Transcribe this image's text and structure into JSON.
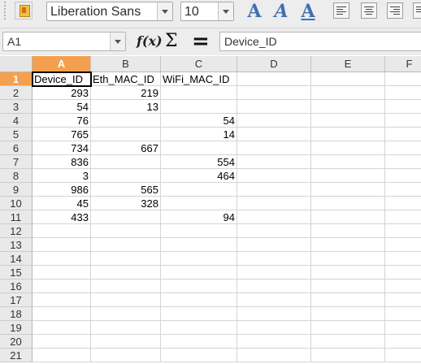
{
  "toolbar": {
    "font_name": "Liberation Sans",
    "font_size": "10",
    "format_buttons": [
      {
        "icon": "font-effect-icon",
        "glyph": "A"
      },
      {
        "icon": "italic-icon",
        "glyph": "A"
      },
      {
        "icon": "underline-icon",
        "glyph": "A"
      }
    ],
    "align_buttons": [
      "align-left-icon",
      "align-center-icon",
      "align-right-icon",
      "justify-icon"
    ]
  },
  "formula_bar": {
    "name_box": "A1",
    "function_wizard": "f(x)",
    "sum_symbol": "Σ",
    "equals_symbol": "=",
    "content": "Device_ID"
  },
  "sheet": {
    "columns": [
      "A",
      "B",
      "C",
      "D",
      "E",
      "F"
    ],
    "selected_column": "A",
    "selected_row": 1,
    "rows": [
      {
        "n": "1",
        "cells": [
          "Device_ID",
          "Eth_MAC_ID",
          "WiFi_MAC_ID",
          "",
          "",
          ""
        ]
      },
      {
        "n": "2",
        "cells": [
          "293",
          "219",
          "",
          "",
          "",
          ""
        ]
      },
      {
        "n": "3",
        "cells": [
          "54",
          "13",
          "",
          "",
          "",
          ""
        ]
      },
      {
        "n": "4",
        "cells": [
          "76",
          "",
          "54",
          "",
          "",
          ""
        ]
      },
      {
        "n": "5",
        "cells": [
          "765",
          "",
          "14",
          "",
          "",
          ""
        ]
      },
      {
        "n": "6",
        "cells": [
          "734",
          "667",
          "",
          "",
          "",
          ""
        ]
      },
      {
        "n": "7",
        "cells": [
          "836",
          "",
          "554",
          "",
          "",
          ""
        ]
      },
      {
        "n": "8",
        "cells": [
          "3",
          "",
          "464",
          "",
          "",
          ""
        ]
      },
      {
        "n": "9",
        "cells": [
          "986",
          "565",
          "",
          "",
          "",
          ""
        ]
      },
      {
        "n": "10",
        "cells": [
          "45",
          "328",
          "",
          "",
          "",
          ""
        ]
      },
      {
        "n": "11",
        "cells": [
          "433",
          "",
          "94",
          "",
          "",
          ""
        ]
      },
      {
        "n": "12",
        "cells": [
          "",
          "",
          "",
          "",
          "",
          ""
        ]
      },
      {
        "n": "13",
        "cells": [
          "",
          "",
          "",
          "",
          "",
          ""
        ]
      },
      {
        "n": "14",
        "cells": [
          "",
          "",
          "",
          "",
          "",
          ""
        ]
      },
      {
        "n": "15",
        "cells": [
          "",
          "",
          "",
          "",
          "",
          ""
        ]
      },
      {
        "n": "16",
        "cells": [
          "",
          "",
          "",
          "",
          "",
          ""
        ]
      },
      {
        "n": "17",
        "cells": [
          "",
          "",
          "",
          "",
          "",
          ""
        ]
      },
      {
        "n": "18",
        "cells": [
          "",
          "",
          "",
          "",
          "",
          ""
        ]
      },
      {
        "n": "19",
        "cells": [
          "",
          "",
          "",
          "",
          "",
          ""
        ]
      },
      {
        "n": "20",
        "cells": [
          "",
          "",
          "",
          "",
          "",
          ""
        ]
      },
      {
        "n": "21",
        "cells": [
          "",
          "",
          "",
          "",
          "",
          ""
        ]
      }
    ]
  }
}
